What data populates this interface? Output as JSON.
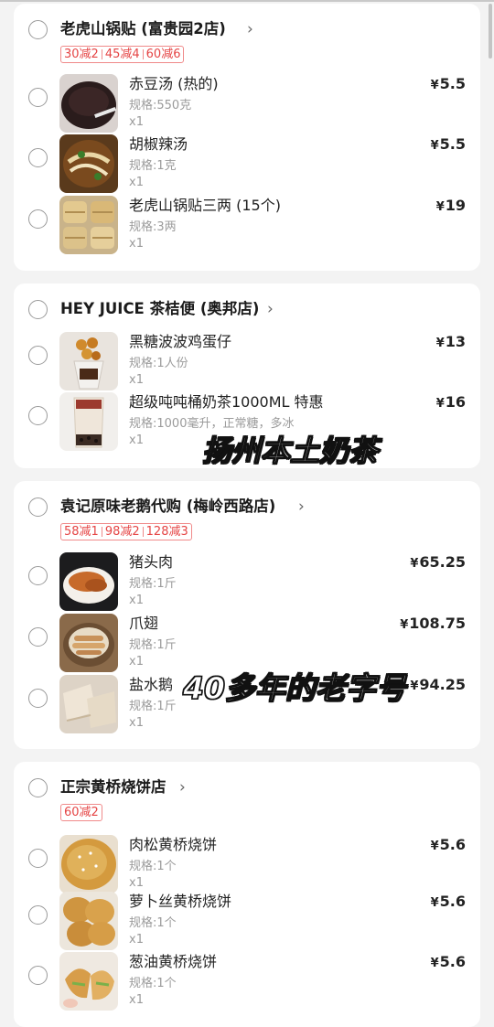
{
  "shops": [
    {
      "name": "老虎山锅贴 (富贵园2店)",
      "promos": [
        "30减2",
        "45减4",
        "60减6"
      ],
      "items": [
        {
          "name": "赤豆汤 (热的)",
          "spec": "规格:550克",
          "qty": "x1",
          "currency": "¥",
          "price": "5.5",
          "image": "red-bean-soup-photo"
        },
        {
          "name": "胡椒辣汤",
          "spec": "规格:1克",
          "qty": "x1",
          "currency": "¥",
          "price": "5.5",
          "image": "pepper-soup-photo"
        },
        {
          "name": "老虎山锅贴三两 (15个)",
          "spec": "规格:3两",
          "qty": "x1",
          "currency": "¥",
          "price": "19",
          "image": "potstickers-photo"
        }
      ]
    },
    {
      "name": "HEY JUICE 茶桔便 (奥邦店)",
      "promos": [],
      "items": [
        {
          "name": "黑糖波波鸡蛋仔",
          "spec": "规格:1人份",
          "qty": "x1",
          "currency": "¥",
          "price": "13",
          "image": "egg-waffle-photo"
        },
        {
          "name": "超级吨吨桶奶茶1000ML 特惠",
          "spec": "规格:1000毫升，正常糖，多冰",
          "qty": "x1",
          "currency": "¥",
          "price": "16",
          "image": "milk-tea-photo"
        }
      ]
    },
    {
      "name": "袁记原味老鹅代购 (梅岭西路店)",
      "promos": [
        "58减1",
        "98减2",
        "128减3"
      ],
      "items": [
        {
          "name": "猪头肉",
          "spec": "规格:1斤",
          "qty": "x1",
          "currency": "¥",
          "price": "65.25",
          "image": "pork-head-photo"
        },
        {
          "name": "爪翅",
          "spec": "规格:1斤",
          "qty": "x1",
          "currency": "¥",
          "price": "108.75",
          "image": "wings-feet-photo"
        },
        {
          "name": "盐水鹅",
          "spec": "规格:1斤",
          "qty": "x1",
          "currency": "¥",
          "price": "94.25",
          "image": "salted-goose-photo"
        }
      ]
    },
    {
      "name": "正宗黄桥烧饼店",
      "promos": [
        "60减2"
      ],
      "items": [
        {
          "name": "肉松黄桥烧饼",
          "spec": "规格:1个",
          "qty": "x1",
          "currency": "¥",
          "price": "5.6",
          "image": "floss-shaobing-photo"
        },
        {
          "name": "萝卜丝黄桥烧饼",
          "spec": "规格:1个",
          "qty": "x1",
          "currency": "¥",
          "price": "5.6",
          "image": "radish-shaobing-photo"
        },
        {
          "name": "葱油黄桥烧饼",
          "spec": "规格:1个",
          "qty": "x1",
          "currency": "¥",
          "price": "5.6",
          "image": "scallion-shaobing-photo"
        }
      ]
    }
  ],
  "overlays": [
    "扬州本土奶茶",
    "40多年的老字号"
  ],
  "colors": {
    "promo_text": "#e54545",
    "promo_border": "#f08a8a",
    "card": "#ffffff",
    "page_bg": "#f3f3f3"
  }
}
